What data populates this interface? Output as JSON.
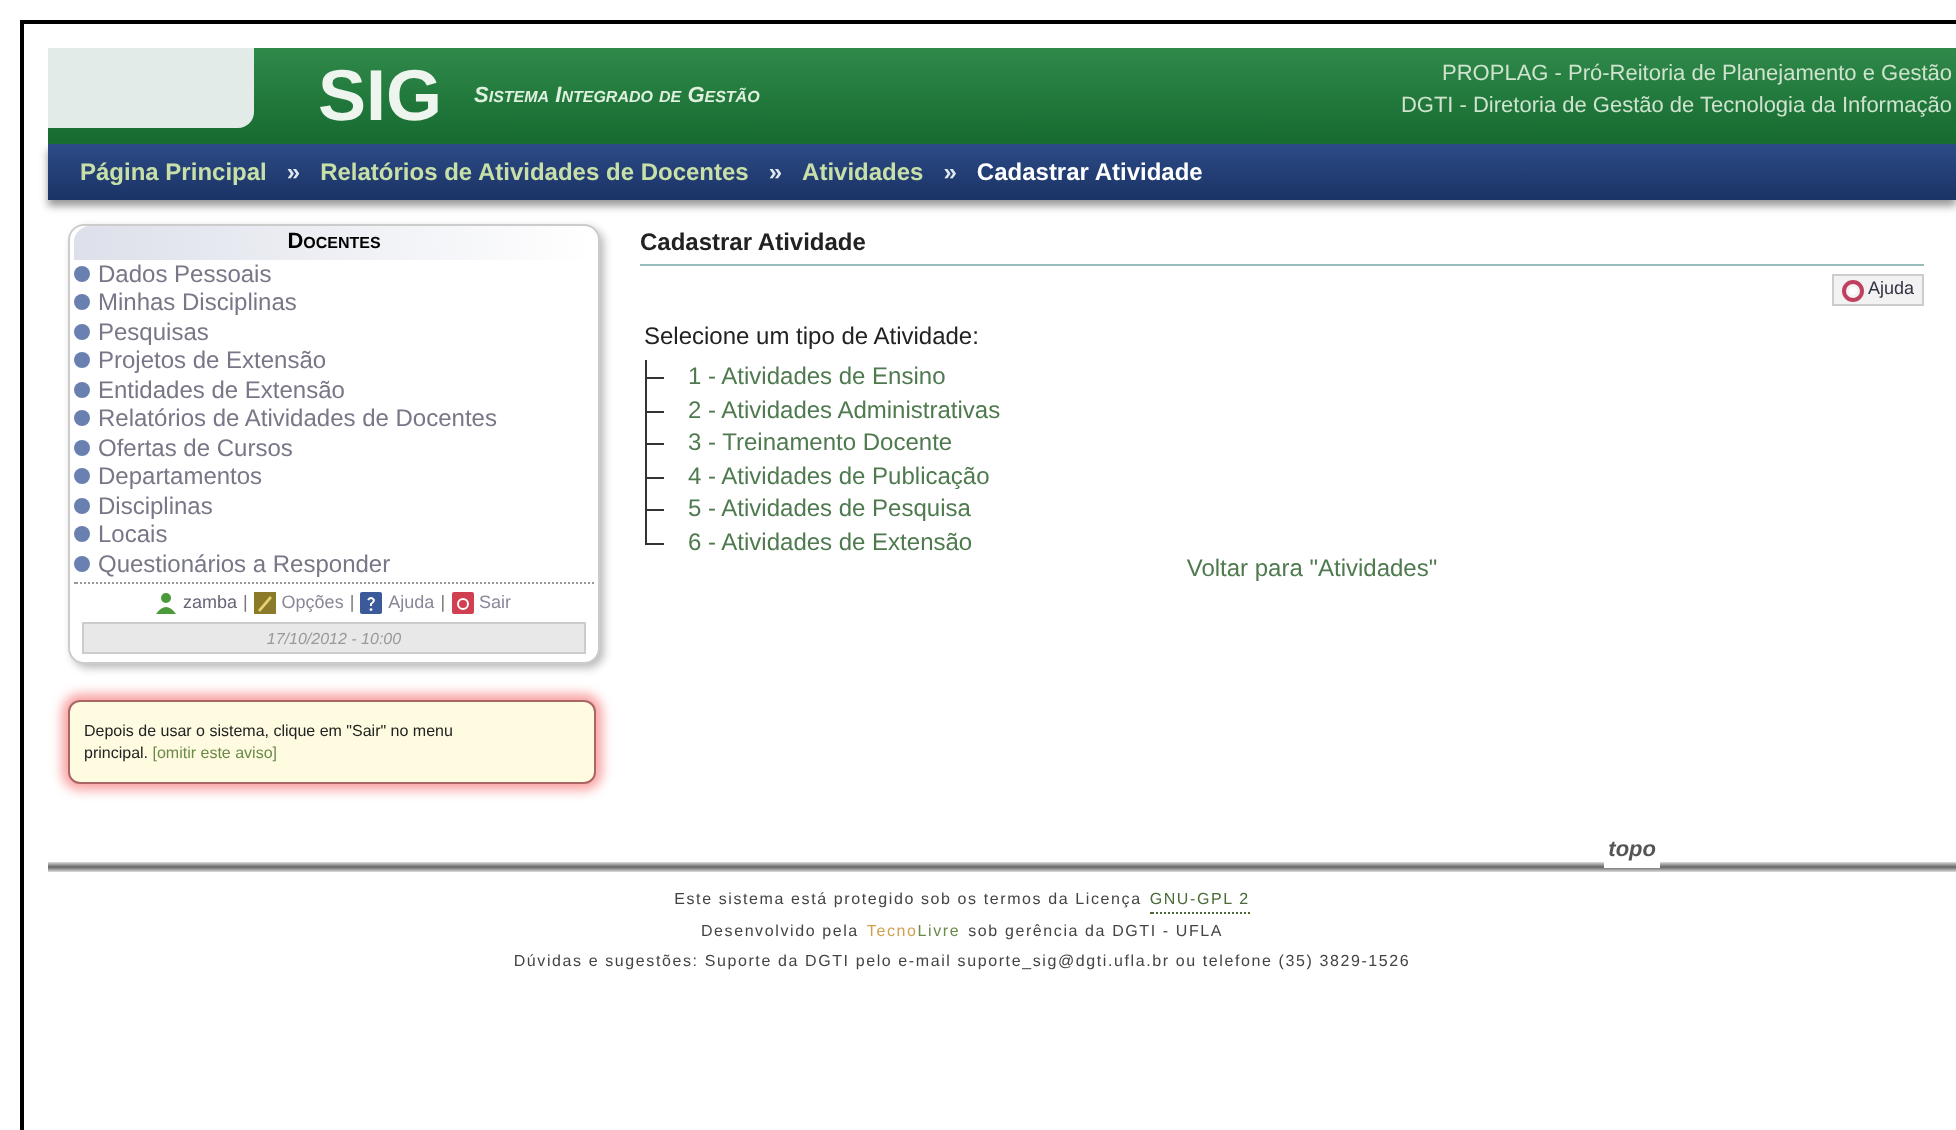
{
  "header": {
    "logo": "SIG",
    "subtitle": "Sistema Integrado de Gestão",
    "org_lines": [
      "PROPLAG - Pró-Reitoria de Planejamento e Gestão",
      "DGTI - Diretoria de Gestão de Tecnologia da Informação"
    ]
  },
  "breadcrumb": [
    {
      "label": "Página Principal",
      "current": false
    },
    {
      "label": "Relatórios de Atividades de Docentes",
      "current": false
    },
    {
      "label": "Atividades",
      "current": false
    },
    {
      "label": "Cadastrar Atividade",
      "current": true
    }
  ],
  "breadcrumb_separator": "»",
  "user_link_separator": "|",
  "sidebar": {
    "title": "Docentes",
    "items": [
      "Dados Pessoais",
      "Minhas Disciplinas",
      "Pesquisas",
      "Projetos de Extensão",
      "Entidades de Extensão",
      "Relatórios de Atividades de Docentes",
      "Ofertas de Cursos",
      "Departamentos",
      "Disciplinas",
      "Locais",
      "Questionários a Responder"
    ],
    "user_links": [
      {
        "kind": "user",
        "label": "zamba"
      },
      {
        "kind": "options",
        "label": "Opções"
      },
      {
        "kind": "help",
        "label": "Ajuda"
      },
      {
        "kind": "exit",
        "label": "Sair"
      }
    ],
    "datetime": "17/10/2012 - 10:00"
  },
  "notice": {
    "text": "Depois de usar o sistema, clique em \"Sair\" no menu principal.",
    "link": "[omitir este aviso]"
  },
  "main": {
    "title": "Cadastrar Atividade",
    "help_button": "Ajuda",
    "prompt": "Selecione um tipo de Atividade:",
    "options": [
      "1 - Atividades de Ensino",
      "2 - Atividades Administrativas",
      "3 - Treinamento Docente",
      "4 - Atividades de Publicação",
      "5 - Atividades de Pesquisa",
      "6 - Atividades de Extensão"
    ],
    "back_link": "Voltar para \"Atividades\""
  },
  "footer": {
    "top_link": "topo",
    "license_text": "Este sistema está protegido sob os termos da Licença",
    "license_link": "GNU-GPL 2",
    "dev_prefix": "Desenvolvido pela",
    "dev_brand": [
      "Tecno",
      "Livre"
    ],
    "dev_suffix": "sob gerência da DGTI - UFLA",
    "contact": "Dúvidas e sugestões: Suporte da DGTI pelo e-mail suporte_sig@dgti.ufla.br ou telefone (35) 3829-1526"
  }
}
